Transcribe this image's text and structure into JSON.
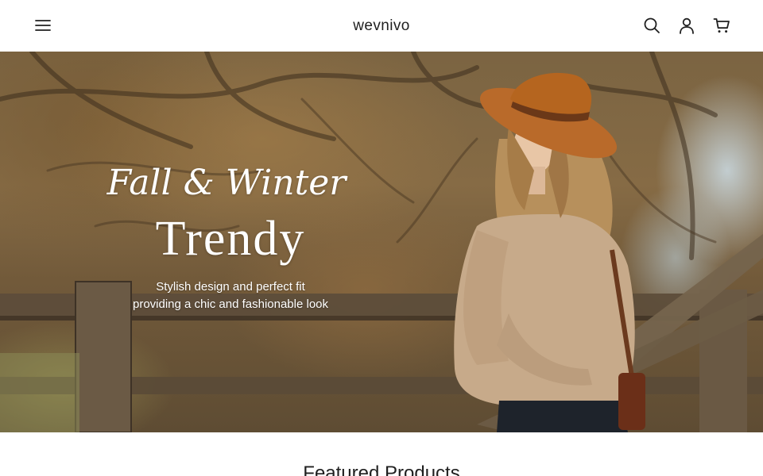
{
  "header": {
    "brand": "wevnivo",
    "icons": [
      "menu-icon",
      "search-icon",
      "account-icon",
      "cart-icon"
    ]
  },
  "hero": {
    "kicker": "Fall & Winter",
    "title": "Trendy",
    "subtitle_line1": "Stylish design and perfect fit",
    "subtitle_line2": "providing a chic and fashionable look"
  },
  "featured": {
    "heading": "Featured Products"
  },
  "colors": {
    "header_bg": "#ffffff",
    "text": "#1f1f1f",
    "hero_text": "#ffffff",
    "hat": "#b96a2a",
    "sweater": "#c7aa8a"
  }
}
